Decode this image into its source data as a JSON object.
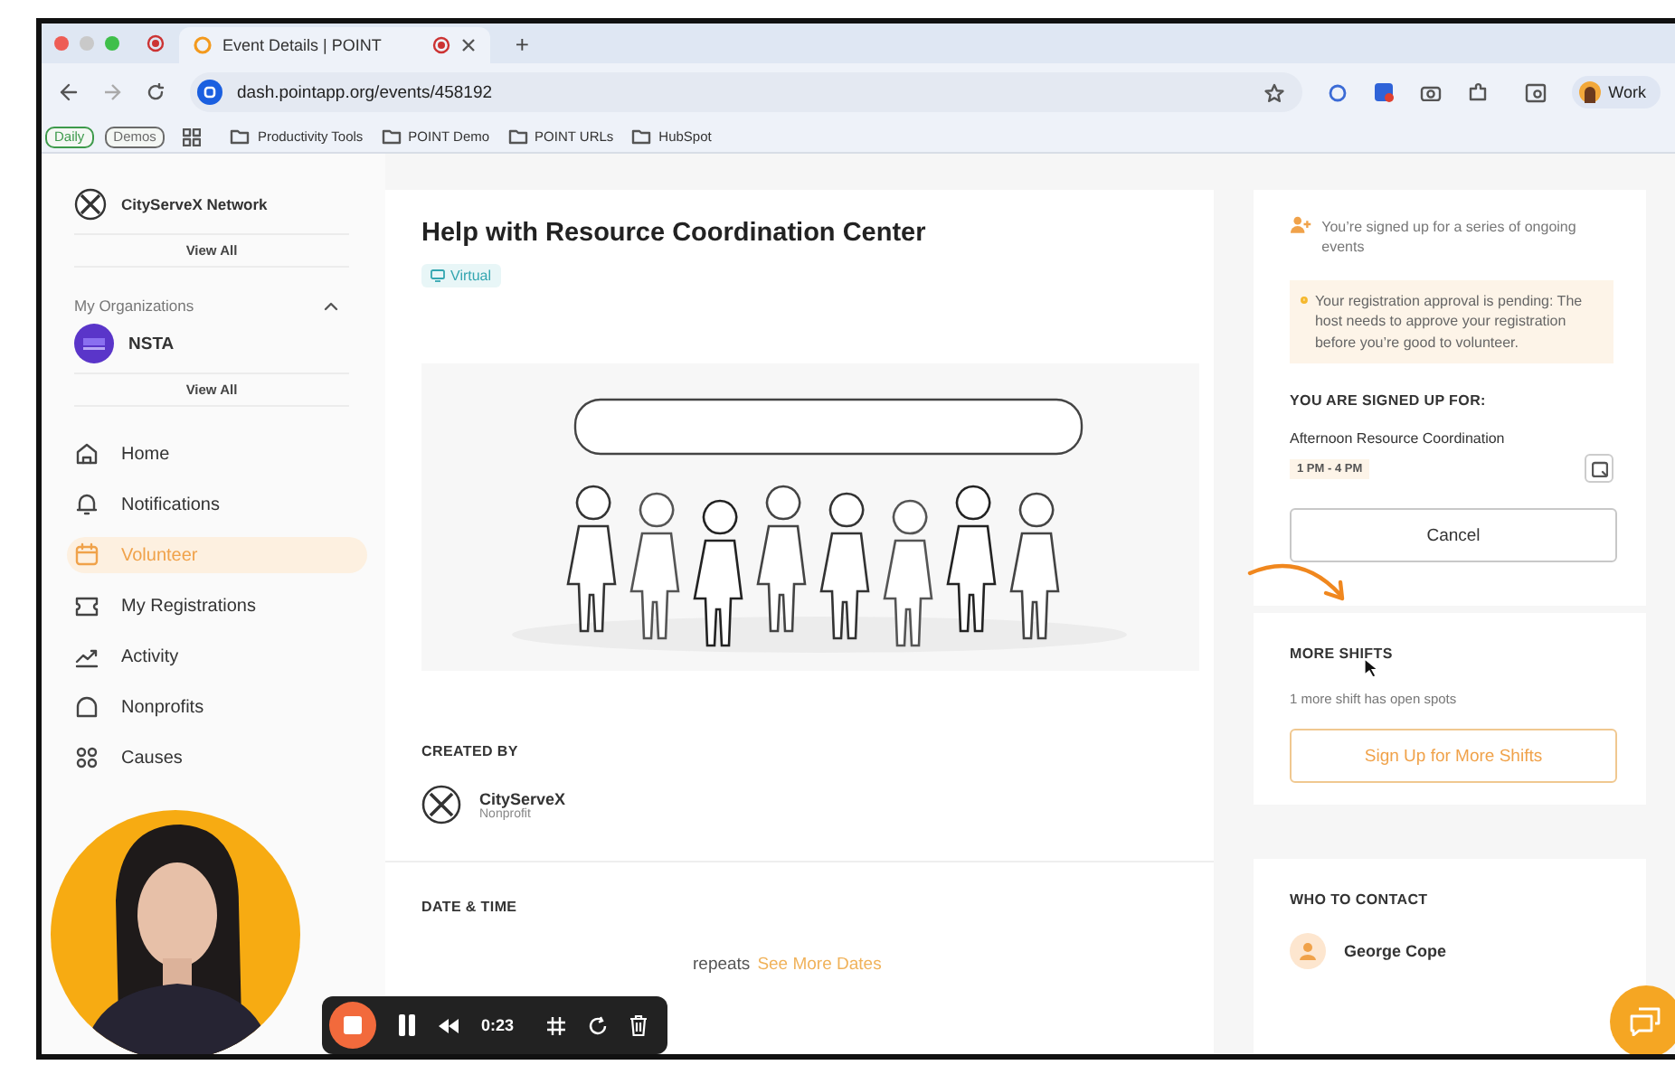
{
  "browser": {
    "tabs": [
      {
        "title": "Event Details | POINT",
        "selected": true
      }
    ],
    "new_tab": "+",
    "address": "dash.pointapp.org/events/458192",
    "profile": "Work",
    "bookmark_chips": [
      {
        "label": "Daily",
        "color": "#3d9a4b"
      },
      {
        "label": "Demos",
        "color": "#6b6b6b"
      }
    ],
    "bookmark_folders": [
      "Productivity Tools",
      "POINT Demo",
      "POINT URLs",
      "HubSpot"
    ]
  },
  "sidebar": {
    "org": "CityServeX Network",
    "org_view_all": "View All",
    "organizations": {
      "title": "My Organizations",
      "expanded": true,
      "items": [
        {
          "name": "NSTA"
        }
      ],
      "view_all": "View All"
    },
    "nav": [
      {
        "label": "Home",
        "selected": false
      },
      {
        "label": "Notifications",
        "selected": false
      },
      {
        "label": "Volunteer",
        "selected": true
      },
      {
        "label": "My Registrations",
        "selected": false
      },
      {
        "label": "Activity",
        "selected": false
      },
      {
        "label": "Nonprofits",
        "selected": false
      },
      {
        "label": "Causes",
        "selected": false
      }
    ]
  },
  "event": {
    "title": "Help with Resource Coordination Center",
    "tag": "Virtual",
    "created_by": {
      "heading": "CREATED BY",
      "name": "CityServeX",
      "type": "Nonprofit"
    },
    "date_time": {
      "heading": "DATE & TIME",
      "text": "repeats",
      "link": "See More Dates"
    }
  },
  "registration": {
    "series_note": "You’re signed up for a series of ongoing events",
    "alert": "Your registration approval is pending: The host needs to approve your registration before you’re good to volunteer.",
    "heading": "YOU ARE SIGNED UP FOR:",
    "shift": "Afternoon Resource Coordination",
    "time": "1 PM - 4 PM",
    "cancel": "Cancel"
  },
  "more_shifts": {
    "heading": "MORE SHIFTS",
    "text": "1 more shift has open spots",
    "button": "Sign Up for More Shifts"
  },
  "contact": {
    "heading": "WHO TO CONTACT",
    "name": "George Cope"
  },
  "recorder": {
    "time": "0:23"
  }
}
